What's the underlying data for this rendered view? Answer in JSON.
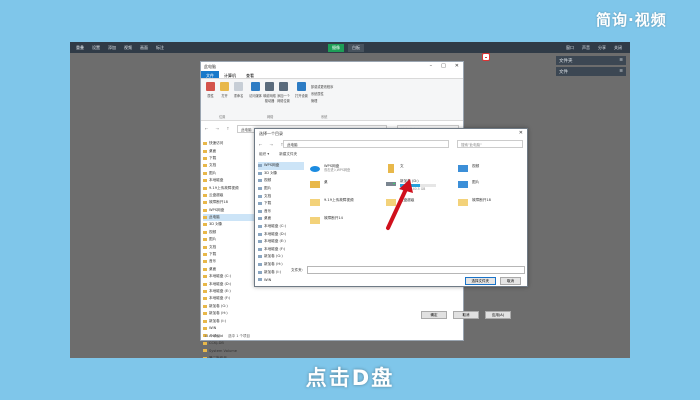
{
  "brand": "简询·视频",
  "topbar": {
    "left": [
      "重叠",
      "设置",
      "添加",
      "视频",
      "画面",
      "标注"
    ],
    "center": [
      "摄像",
      "白板"
    ],
    "right": [
      "窗口",
      "声音",
      "分享",
      "关闭"
    ]
  },
  "right_panel": [
    "文件夹",
    "文件"
  ],
  "explorer": {
    "title": "此电脑",
    "tabs": [
      "文件",
      "计算机",
      "查看"
    ],
    "ribbon": {
      "buttons": [
        "属性",
        "打开",
        "重命名",
        "访问媒体",
        "映射网络驱动器",
        "添加一个网络位置",
        "打开设置",
        "卸载或更改程序",
        "系统属性",
        "管理"
      ],
      "groups": [
        "位置",
        "网络",
        "系统"
      ]
    },
    "address": "此电脑",
    "search_placeholder": "搜索\"此电脑\"",
    "sidebar": [
      "快速访问",
      "桌面",
      "下载",
      "文档",
      "图片",
      "本地磁盘",
      "9.19上传故障视频",
      "云盘超级",
      "故障断开18",
      "WPS网盘",
      "此电脑",
      "3D 对象",
      "视频",
      "图片",
      "文档",
      "下载",
      "音乐",
      "桌面",
      "本地磁盘 (C:)",
      "本地磁盘 (D:)",
      "本地磁盘 (E:)",
      "本地磁盘 (F:)",
      "新加卷 (G:)",
      "新加卷 (H:)",
      "新加卷 (I:)",
      "WIN",
      "Android",
      "CCKJ-DB",
      "System Volume",
      "第二批作品",
      "网络"
    ],
    "status": [
      "14 个项目",
      "选中 1 个项目"
    ],
    "hidden_buttons": [
      "确定",
      "取消",
      "应用(A)"
    ]
  },
  "dialog": {
    "title": "选择一个目录",
    "address": "此电脑",
    "search_placeholder": "搜索\"此电脑\"",
    "toolbar": [
      "组织 ▾",
      "新建文件夹"
    ],
    "tree": [
      "WPS网盘",
      "3D 对象",
      "视频",
      "图片",
      "文档",
      "下载",
      "音乐",
      "桌面",
      "本地磁盘 (C:)",
      "本地磁盘 (D:)",
      "本地磁盘 (E:)",
      "本地磁盘 (F:)",
      "新加卷 (G:)",
      "新加卷 (H:)",
      "新加卷 (I:)",
      "WIN"
    ],
    "items": [
      {
        "name": "WPS网盘",
        "sub": "双击进入WPS网盘"
      },
      {
        "name": "文"
      },
      {
        "name": "视频"
      },
      {
        "name": "桌"
      },
      {
        "name": "新加卷 (D:)",
        "sub": "可用, 共 40.5 GB",
        "progress": 0.55
      },
      {
        "name": "图片"
      },
      {
        "name": "9.19上传故障视频"
      },
      {
        "name": "云盘超级"
      },
      {
        "name": "故障断开18"
      },
      {
        "name": "故障断开14"
      }
    ],
    "filename_label": "文件夹:",
    "buttons": [
      "选择文件夹",
      "取消"
    ]
  },
  "caption": "点击D盘",
  "colors": {
    "accent": "#1979ca",
    "annotation": "#d0101c",
    "background": "#7fc6ea"
  }
}
